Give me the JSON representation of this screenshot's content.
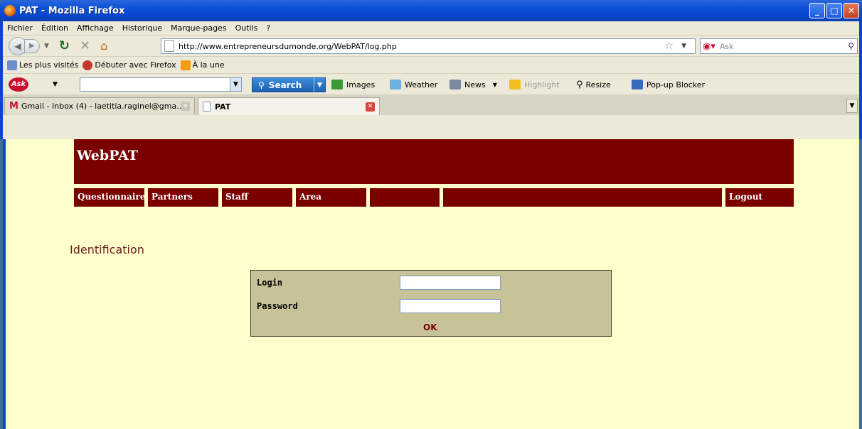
{
  "window": {
    "title": "PAT - Mozilla Firefox"
  },
  "menubar": [
    "Fichier",
    "Édition",
    "Affichage",
    "Historique",
    "Marque-pages",
    "Outils",
    "?"
  ],
  "navbar": {
    "url": "http://www.entrepreneursdumonde.org/WebPAT/log.php",
    "search_placeholder": "Ask"
  },
  "bookmarks": [
    "Les plus visités",
    "Débuter avec Firefox",
    "À la une"
  ],
  "askbar": {
    "logo": "Ask",
    "search_label": "Search",
    "items": [
      "Images",
      "Weather",
      "News",
      "Highlight",
      "Resize",
      "Pop-up Blocker"
    ]
  },
  "tabs": [
    {
      "label": "Gmail - Inbox (4) - laetitia.raginel@gma..."
    },
    {
      "label": "PAT"
    }
  ],
  "page": {
    "brand": "WebPAT",
    "menu": [
      "Questionnaire",
      "Partners",
      "Staff",
      "Area",
      "",
      "",
      "Logout"
    ],
    "section_title": "Identification",
    "login_label": "Login",
    "password_label": "Password",
    "login_value": "",
    "password_value": "",
    "ok_label": "OK"
  },
  "colors": {
    "banner": "#7a0000",
    "page_bg": "#ffffcc",
    "login_box": "#c8c299"
  }
}
